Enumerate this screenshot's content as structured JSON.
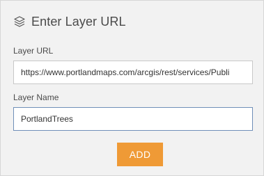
{
  "header": {
    "icon": "layers-icon",
    "title": "Enter Layer URL"
  },
  "form": {
    "url_label": "Layer URL",
    "url_value": "https://www.portlandmaps.com/arcgis/rest/services/Publi",
    "name_label": "Layer Name",
    "name_value": "PortlandTrees"
  },
  "actions": {
    "add_label": "ADD"
  },
  "colors": {
    "panel_bg": "#f2f2f2",
    "accent": "#ef9a36",
    "focus_border": "#6f8fb8"
  }
}
